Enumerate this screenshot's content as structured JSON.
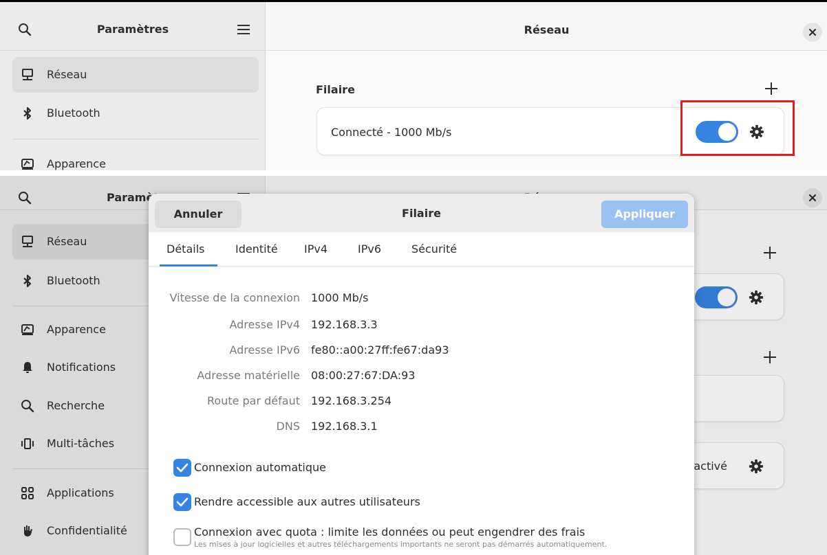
{
  "top": {
    "sidebar": {
      "title": "Paramètres",
      "items": [
        {
          "label": "Réseau",
          "icon": "network-icon",
          "active": true
        },
        {
          "label": "Bluetooth",
          "icon": "bluetooth-icon"
        },
        {
          "label": "Apparence",
          "icon": "appearance-icon"
        }
      ]
    },
    "main": {
      "title": "Réseau",
      "section_wired": "Filaire",
      "wired_status": "Connecté - 1000 Mb/s",
      "wired_enabled": true
    }
  },
  "bottom": {
    "sidebar": {
      "title": "Paramèt",
      "items": [
        {
          "label": "Réseau",
          "icon": "network-icon",
          "active": true
        },
        {
          "label": "Bluetooth",
          "icon": "bluetooth-icon"
        },
        {
          "label": "Apparence",
          "icon": "appearance-icon"
        },
        {
          "label": "Notifications",
          "icon": "bell-icon"
        },
        {
          "label": "Recherche",
          "icon": "search-icon"
        },
        {
          "label": "Multi-tâches",
          "icon": "multitasking-icon"
        },
        {
          "label": "Applications",
          "icon": "apps-grid-icon"
        },
        {
          "label": "Confidentialité",
          "icon": "privacy-hand-icon"
        }
      ]
    },
    "main": {
      "title": "Réseau",
      "vpn_status_partial": "sactivé"
    },
    "dialog": {
      "title": "Filaire",
      "cancel_label": "Annuler",
      "apply_label": "Appliquer",
      "tabs": [
        "Détails",
        "Identité",
        "IPv4",
        "IPv6",
        "Sécurité"
      ],
      "active_tab": "Détails",
      "details": [
        {
          "label": "Vitesse de la connexion",
          "value": "1000 Mb/s"
        },
        {
          "label": "Adresse IPv4",
          "value": "192.168.3.3"
        },
        {
          "label": "Adresse IPv6",
          "value": "fe80::a00:27ff:fe67:da93"
        },
        {
          "label": "Adresse matérielle",
          "value": "08:00:27:67:DA:93"
        },
        {
          "label": "Route par défaut",
          "value": "192.168.3.254"
        },
        {
          "label": "DNS",
          "value": "192.168.3.1"
        }
      ],
      "checkboxes": [
        {
          "label": "Connexion automatique",
          "checked": true
        },
        {
          "label": "Rendre accessible aux autres utilisateurs",
          "checked": true
        },
        {
          "label": "Connexion avec quota : limite les données ou peut engendrer des frais",
          "checked": false,
          "sublabel": "Les mises à jour logicielles et autres téléchargements importants ne seront pas démarrés automatiquement."
        }
      ]
    }
  },
  "colors": {
    "accent": "#3584e4",
    "accent_disabled": "#99c1f1",
    "highlight": "#e01b24"
  }
}
